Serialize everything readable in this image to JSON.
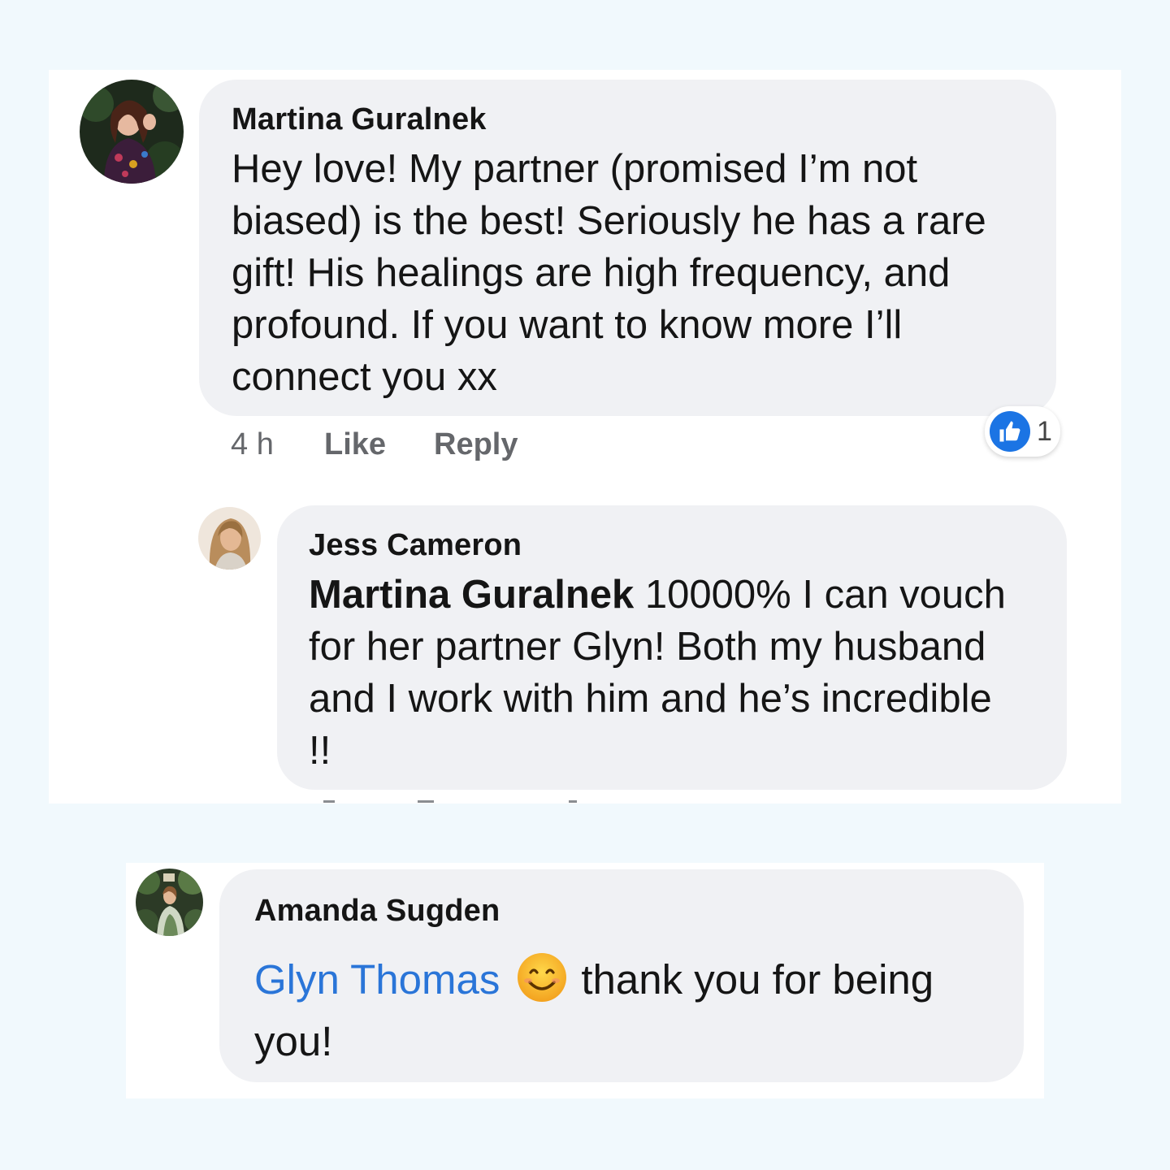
{
  "colors": {
    "page_background": "#f1f9fd",
    "bubble": "#f0f1f4",
    "link": "#2a75d8",
    "like_blue": "#1b74e4",
    "meta_text": "#65676b"
  },
  "comments": [
    {
      "author": "Martina Guralnek",
      "avatar_icon": "avatar-photo-martina",
      "lines": [
        "Hey love! My partner (promised I’m not",
        "biased) is the best! Seriously he has a rare",
        "gift! His healings are high frequency, and",
        "profound. If you want to know more I’ll",
        "connect you xx"
      ],
      "time": "4 h",
      "like_label": "Like",
      "reply_label": "Reply",
      "reactions": {
        "icon": "thumbs-up-icon",
        "count": "1"
      }
    },
    {
      "author": "Jess Cameron",
      "avatar_icon": "avatar-photo-jess",
      "mention": "Martina Guralnek",
      "lines": [
        " 10000% I can vouch",
        "for her partner Glyn! Both my husband",
        "and I work with him and he’s incredible",
        "!!"
      ]
    },
    {
      "author": "Amanda Sugden",
      "avatar_icon": "avatar-photo-amanda",
      "mention": "Glyn Thomas",
      "emoji": "smiling-face-icon",
      "lines": [
        "thank you for being",
        "you!"
      ]
    }
  ]
}
